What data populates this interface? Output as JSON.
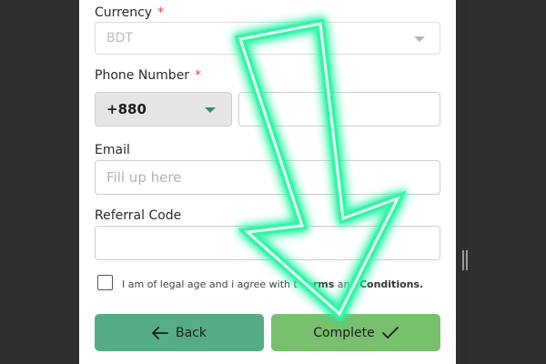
{
  "form": {
    "currency": {
      "label": "Currency",
      "required_mark": "*",
      "value": "BDT"
    },
    "phone": {
      "label": "Phone Number",
      "required_mark": "*",
      "country_code": "+880",
      "value": ""
    },
    "email": {
      "label": "Email",
      "placeholder": "Fill up here"
    },
    "referral": {
      "label": "Referral Code",
      "value": ""
    },
    "agreement": {
      "text_before": "I am of legal age and i agree with t",
      "terms": "Terms",
      "and": "and",
      "conditions": "Conditions."
    }
  },
  "buttons": {
    "back_label": "Back",
    "complete_label": "Complete"
  },
  "icons": {
    "back": "arrow-left-icon",
    "complete": "checkmark-icon",
    "dropdown": "chevron-down-icon"
  },
  "colors": {
    "back_button": "#55ad86",
    "complete_button": "#78c06d",
    "required": "#e0414b",
    "overlay_arrow": "#31f5a6"
  }
}
